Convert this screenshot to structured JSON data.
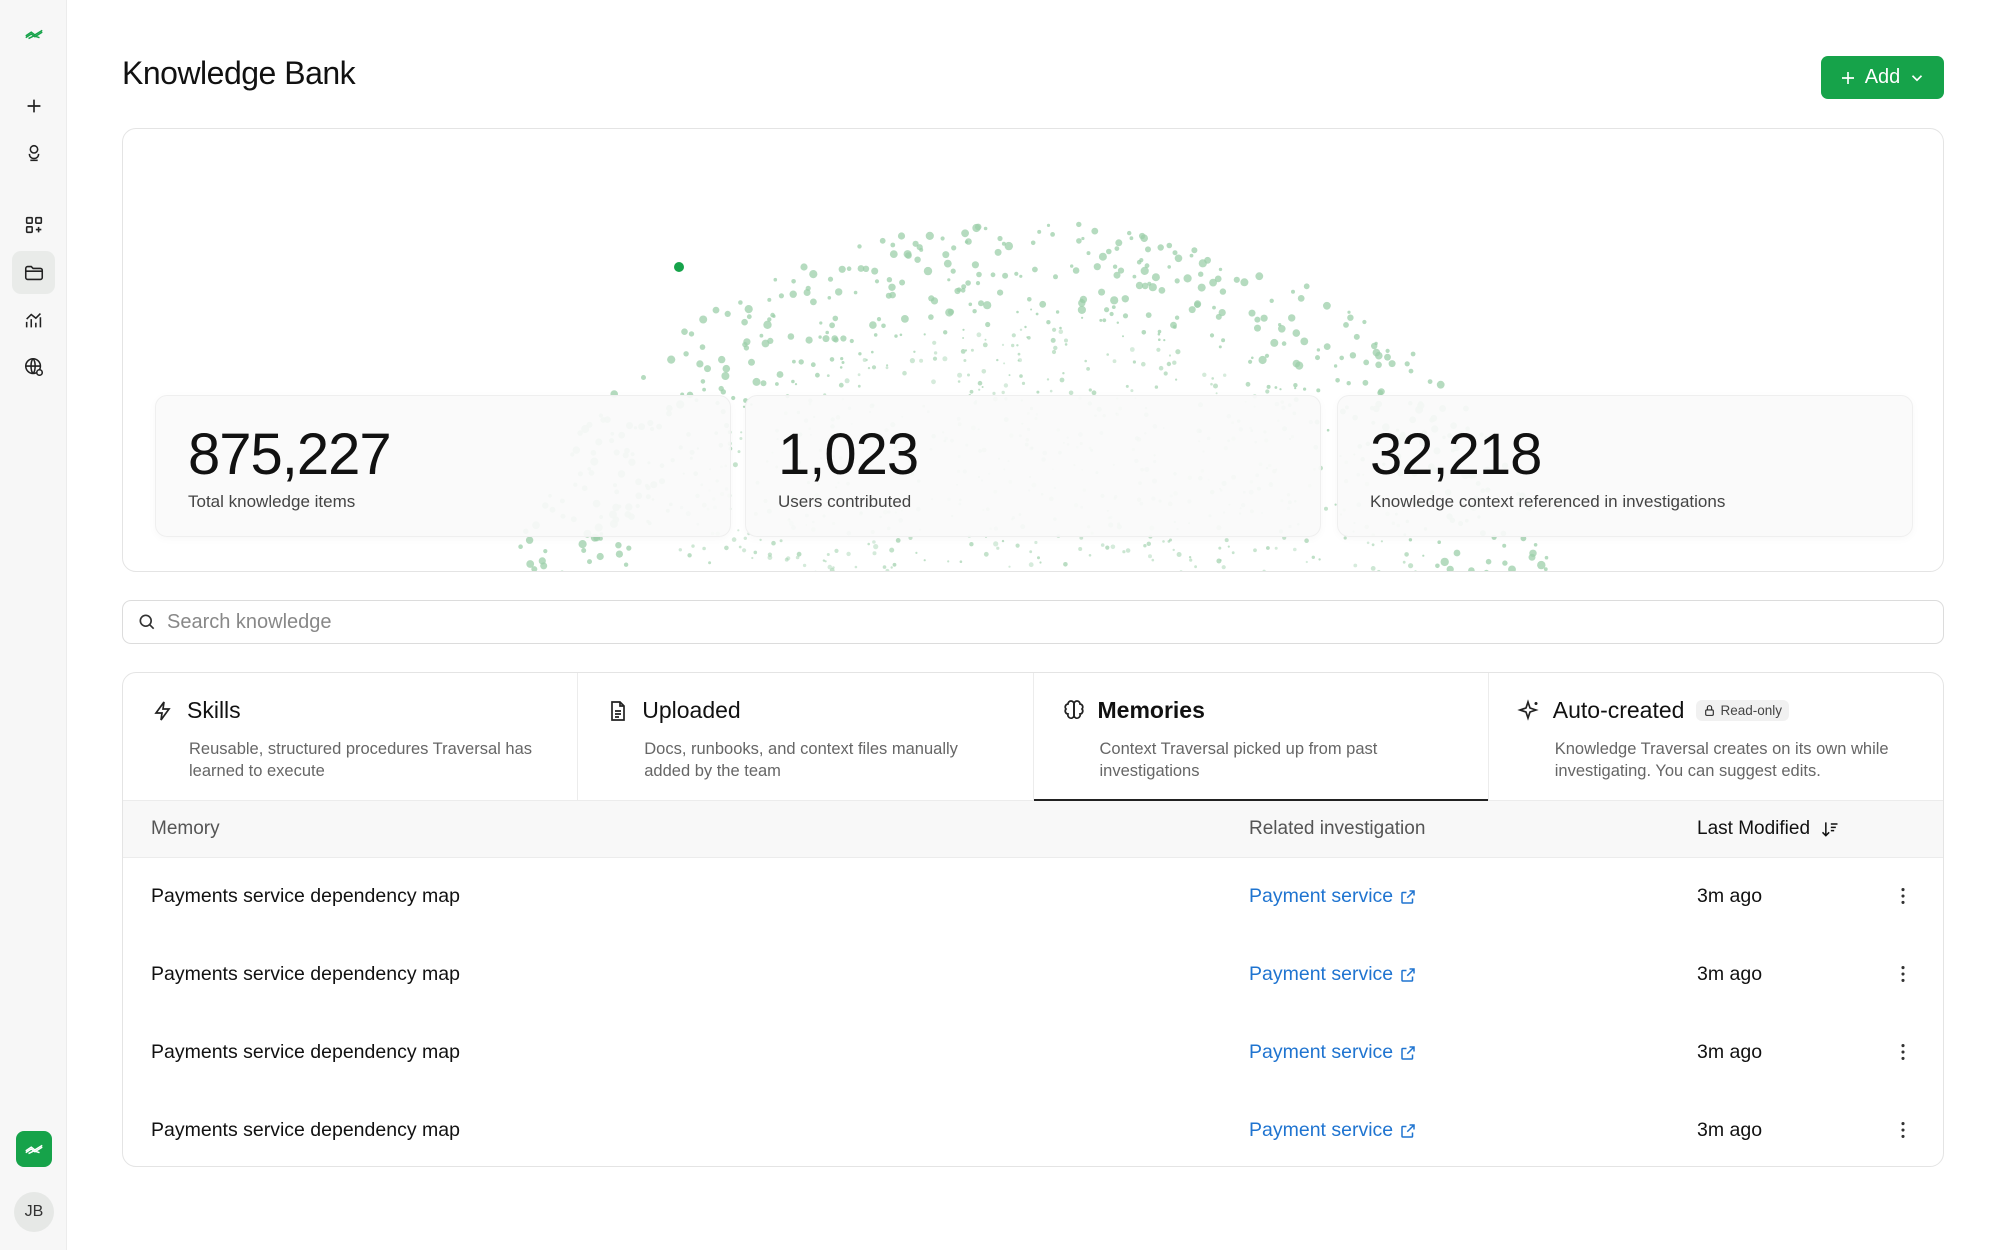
{
  "page": {
    "title": "Knowledge Bank",
    "add_label": "Add"
  },
  "sidebar": {
    "items": [
      {
        "icon": "logo-icon"
      },
      {
        "icon": "plus-icon"
      },
      {
        "icon": "agent-icon"
      },
      {
        "icon": "apps-icon"
      },
      {
        "icon": "folder-icon",
        "active": true
      },
      {
        "icon": "analytics-icon"
      },
      {
        "icon": "globe-settings-icon"
      }
    ],
    "avatar_initials": "JB"
  },
  "stats": [
    {
      "value": "875,227",
      "label": "Total knowledge items"
    },
    {
      "value": "1,023",
      "label": "Users contributed"
    },
    {
      "value": "32,218",
      "label": "Knowledge context referenced in investigations"
    }
  ],
  "search": {
    "placeholder": "Search knowledge"
  },
  "tabs": [
    {
      "title": "Skills",
      "desc": "Reusable, structured procedures Traversal has learned to execute",
      "icon": "bolt-icon"
    },
    {
      "title": "Uploaded",
      "desc": "Docs, runbooks, and context files manually added by the team",
      "icon": "document-icon"
    },
    {
      "title": "Memories",
      "desc": "Context Traversal picked up from past investigations",
      "icon": "brain-icon",
      "active": true
    },
    {
      "title": "Auto-created",
      "badge": "Read-only",
      "desc": "Knowledge Traversal creates on its own while investigating. You can suggest edits.",
      "icon": "sparkle-icon"
    }
  ],
  "table": {
    "columns": [
      "Memory",
      "Related investigation",
      "Last Modified"
    ],
    "rows": [
      {
        "memory": "Payments service dependency map",
        "investigation": "Payment service",
        "modified": "3m ago"
      },
      {
        "memory": "Payments service dependency map",
        "investigation": "Payment service",
        "modified": "3m ago"
      },
      {
        "memory": "Payments service dependency map",
        "investigation": "Payment service",
        "modified": "3m ago"
      },
      {
        "memory": "Payments service dependency map",
        "investigation": "Payment service",
        "modified": "3m ago"
      }
    ]
  },
  "colors": {
    "accent": "#16a34a",
    "link": "#1f74d0",
    "dots": "#9ccfa9"
  }
}
